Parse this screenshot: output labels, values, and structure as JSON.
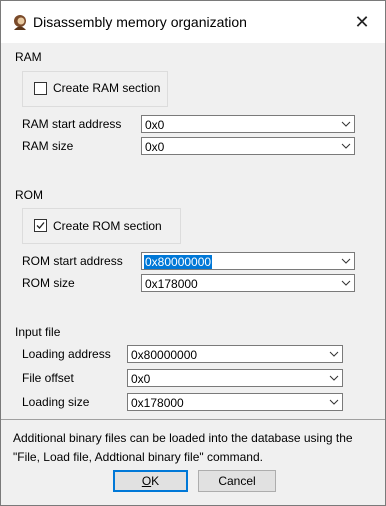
{
  "window": {
    "title": "Disassembly memory organization",
    "close_label": "✕"
  },
  "ram": {
    "group_label": "RAM",
    "checkbox_label": "Create RAM section",
    "checked": false,
    "start_label": "RAM start address",
    "start_value": "0x0",
    "size_label": "RAM size",
    "size_value": "0x0"
  },
  "rom": {
    "group_label": "ROM",
    "checkbox_label": "Create ROM section",
    "checked": true,
    "start_label": "ROM start address",
    "start_value": "0x80000000",
    "size_label": "ROM size",
    "size_value": "0x178000"
  },
  "input": {
    "group_label": "Input file",
    "loading_address_label": "Loading address",
    "loading_address_value": "0x80000000",
    "file_offset_label": "File offset",
    "file_offset_value": "0x0",
    "loading_size_label": "Loading size",
    "loading_size_value": "0x178000"
  },
  "note": {
    "line1": "Additional binary files can be loaded into the database using the",
    "line2": "\"File, Load file, Addtional binary file\" command."
  },
  "buttons": {
    "ok_prefix": "",
    "ok_underlined": "O",
    "ok_rest": "K",
    "cancel": "Cancel"
  },
  "icons": [
    "app-icon",
    "close-icon",
    "chevron-down-icon",
    "checkmark-icon"
  ],
  "colors": {
    "selection": "#0078d7",
    "default_button_border": "#0078d7",
    "dialog_bg": "#f0f0f0"
  }
}
